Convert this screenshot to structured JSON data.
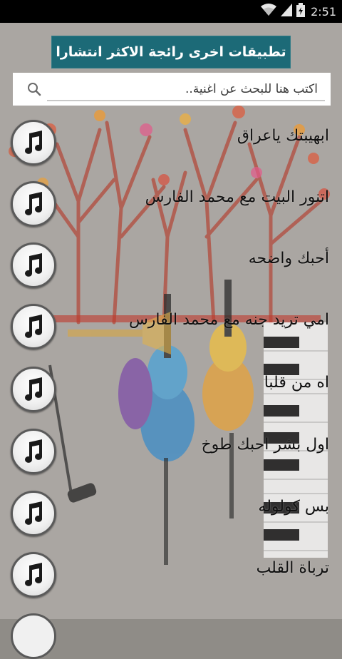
{
  "status_bar": {
    "time": "2:51",
    "icons": [
      "wifi-icon",
      "signal-icon",
      "battery-icon"
    ]
  },
  "apps_button": {
    "label": "تطبيقات اخرى رائجة الاكثر انتشارا"
  },
  "search": {
    "placeholder": "اكتب هنا للبحث عن اغنية..",
    "value": "",
    "icon": "search-icon"
  },
  "songs": [
    {
      "title": "ابهيبتك ياعراق",
      "icon": "music-note-icon"
    },
    {
      "title": "اتنور البيت مع محمد الفارس",
      "icon": "music-note-icon"
    },
    {
      "title": "أحبك واضحه",
      "icon": "music-note-icon"
    },
    {
      "title": "امي تريد جنه مع محمد الفارس",
      "icon": "music-note-icon"
    },
    {
      "title": "اه من قلبا",
      "icon": "music-note-icon"
    },
    {
      "title": "اول بشر احبك طوخ",
      "icon": "music-note-icon"
    },
    {
      "title": "بس كولوله",
      "icon": "music-note-icon"
    },
    {
      "title": "ترباة القلب",
      "icon": "music-note-icon"
    }
  ],
  "colors": {
    "apps_button_bg": "#1c6a77",
    "background": "#aaa6a2",
    "status_bar": "#000000"
  }
}
